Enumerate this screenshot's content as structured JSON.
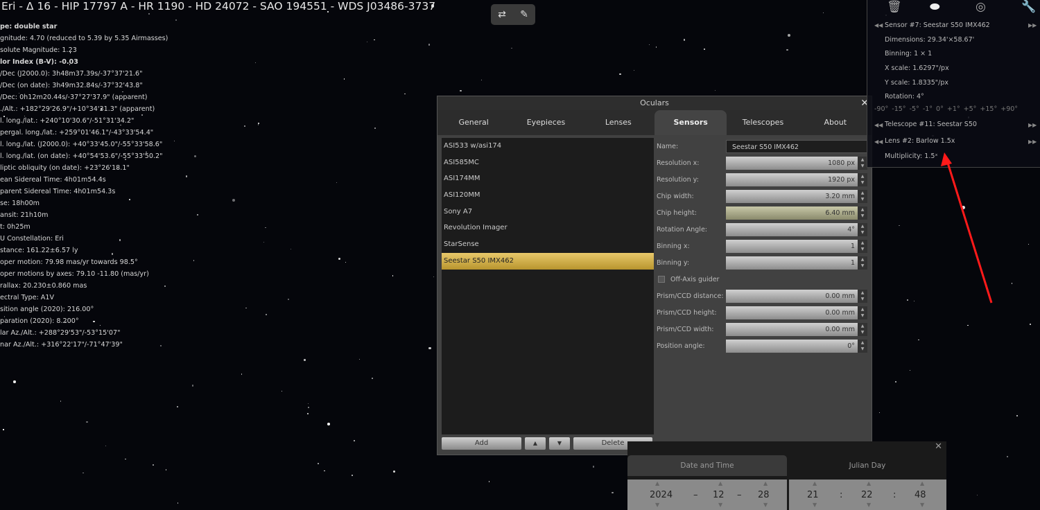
{
  "title": "Eri - Δ 16 - HIP 17797 A - HR 1190 - HD 24072 - SAO 194551 - WDS J03486-3737",
  "info": [
    "pe: double star",
    "gnitude: 4.70 (reduced to 5.39 by 5.35 Airmasses)",
    "solute Magnitude: 1.23",
    "lor Index (B-V): -0.03",
    "/Dec (J2000.0): 3h48m37.39s/-37°37'21.6\"",
    "/Dec (on date): 3h49m32.84s/-37°32'43.8\"",
    "/Dec: 0h12m20.44s/-37°27'37.9\" (apparent)",
    "./Alt.: +182°29'26.9\"/+10°34'31.3\" (apparent)",
    "l. long./lat.: +240°10'30.6\"/-51°31'34.2\"",
    "pergal. long./lat.: +259°01'46.1\"/-43°33'54.4\"",
    "l. long./lat. (J2000.0): +40°33'45.0\"/-55°33'58.6\"",
    "l. long./lat. (on date): +40°54'53.6\"/-55°33'50.2\"",
    "liptic obliquity (on date): +23°26'18.1\"",
    "ean Sidereal Time: 4h01m54.4s",
    "parent Sidereal Time: 4h01m54.3s",
    "se: 18h00m",
    "ansit: 21h10m",
    "t: 0h25m",
    "U Constellation: Eri",
    "stance: 161.22±6.57 ly",
    "oper motion: 79.98 mas/yr towards 98.5°",
    "oper motions by axes: 79.10 -11.80 (mas/yr)",
    "rallax: 20.230±0.860 mas",
    "ectral Type: A1V",
    "sition angle (2020): 216.00°",
    "paration (2020): 8.200°",
    "lar Az./Alt.: +288°29'53\"/-53°15'07\"",
    "nar Az./Alt.: +316°22'17\"/-71°47'39\""
  ],
  "dialog": {
    "title": "Oculars",
    "tabs": [
      "General",
      "Eyepieces",
      "Lenses",
      "Sensors",
      "Telescopes",
      "About"
    ],
    "active_tab": "Sensors",
    "sensors": [
      "ASI533 w/asi174",
      "ASI585MC",
      "ASI174MM",
      "ASI120MM",
      "Sony A7",
      "Revolution Imager",
      "StarSense",
      "Seestar S50 IMX462"
    ],
    "selected": "Seestar S50 IMX462",
    "buttons": {
      "add": "Add",
      "up": "▲",
      "down": "▼",
      "delete": "Delete"
    },
    "name_label": "Name:",
    "name_value": "Seestar S50 IMX462",
    "fields": [
      {
        "label": "Resolution x:",
        "value": "1080 px"
      },
      {
        "label": "Resolution y:",
        "value": "1920 px"
      },
      {
        "label": "Chip width:",
        "value": "3.20 mm"
      },
      {
        "label": "Chip height:",
        "value": "6.40 mm"
      },
      {
        "label": "Rotation Angle:",
        "value": "4°"
      },
      {
        "label": "Binning x:",
        "value": "1"
      },
      {
        "label": "Binning y:",
        "value": "1"
      }
    ],
    "offaxis_label": "Off-Axis guider",
    "fields2": [
      {
        "label": "Prism/CCD distance:",
        "value": "0.00 mm"
      },
      {
        "label": "Prism/CCD height:",
        "value": "0.00 mm"
      },
      {
        "label": "Prism/CCD width:",
        "value": "0.00 mm"
      },
      {
        "label": "Position angle:",
        "value": "0°"
      }
    ]
  },
  "panel": {
    "sensor": "Sensor #7: Seestar S50 IMX462",
    "dimensions": "Dimensions: 29.34'×58.67'",
    "binning": "Binning: 1 × 1",
    "xscale": "X scale: 1.6297\"/px",
    "yscale": "Y scale: 1.8335\"/px",
    "rotation": "Rotation: 4°",
    "rot_buttons": "-90°  -15°  -5°  -1°  0°  +1°  +5°  +15°  +90°",
    "telescope": "Telescope #11: Seestar S50",
    "lens": "Lens #2: Barlow 1.5x",
    "multiplicity": "Multiplicity: 1.5ˣ"
  },
  "datetime": {
    "tab1": "Date and Time",
    "tab2": "Julian Day",
    "year": "2024",
    "month": "12",
    "day": "28",
    "hour": "21",
    "minute": "22",
    "second": "48",
    "sep1": "–",
    "sep2": ":"
  },
  "colors": {
    "selected": "#d4b04a",
    "arrow": "#ff1a1a"
  }
}
